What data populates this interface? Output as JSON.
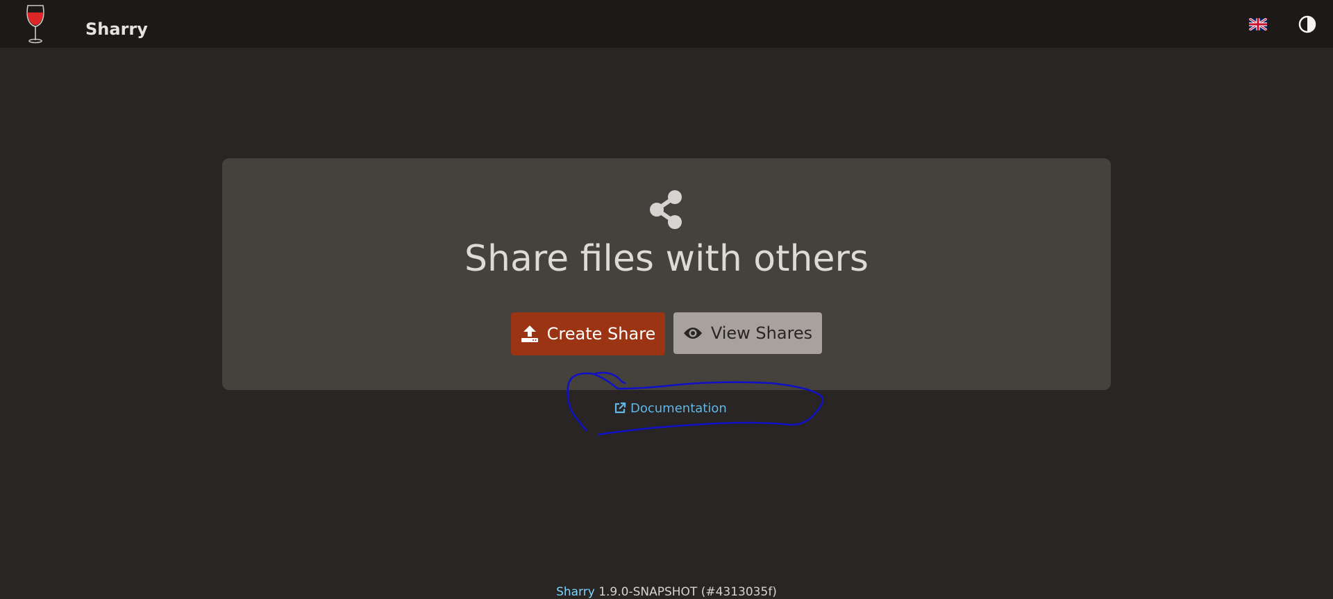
{
  "header": {
    "app_name": "Sharry",
    "logo_icon": "wine-glass-icon",
    "language_icon": "uk-flag-icon",
    "theme_icon": "contrast-icon"
  },
  "hero": {
    "icon": "share-icon",
    "title": "Share files with others",
    "create_button": "Create Share",
    "view_button": "View Shares",
    "documentation_link": "Documentation"
  },
  "footer": {
    "app_name": "Sharry",
    "version": "1.9.0-SNAPSHOT (#4313035f)"
  },
  "colors": {
    "primary": "#9a3412",
    "secondary": "#a8a29e",
    "link": "#5fb8e6",
    "annotation": "#1010c8"
  }
}
